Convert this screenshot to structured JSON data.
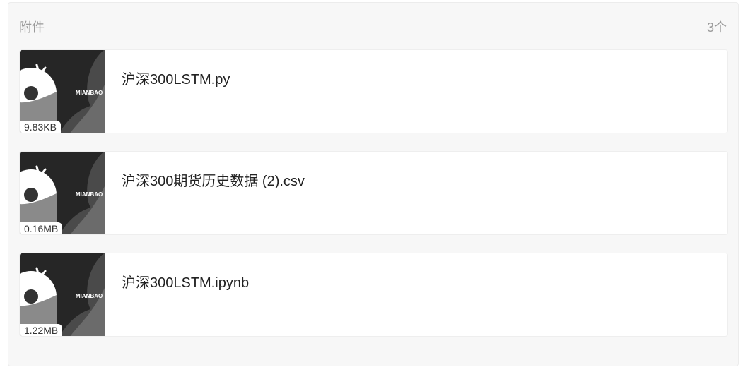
{
  "attachments": {
    "title": "附件",
    "count": "3个",
    "files": [
      {
        "name": "沪深300LSTM.py",
        "size": "9.83KB",
        "thumb_text": "MIANBAO",
        "thumb_icon": "donut-icon"
      },
      {
        "name": "沪深300期货历史数据 (2).csv",
        "size": "0.16MB",
        "thumb_text": "MIANBAO",
        "thumb_icon": "donut-icon"
      },
      {
        "name": "沪深300LSTM.ipynb",
        "size": "1.22MB",
        "thumb_text": "MIANBAO",
        "thumb_icon": "donut-icon"
      }
    ]
  },
  "colors": {
    "panel_bg": "#f7f7f7",
    "thumb_dark": "#262626",
    "thumb_mid": "#4a4a4a",
    "thumb_light": "#6b6b6b"
  }
}
